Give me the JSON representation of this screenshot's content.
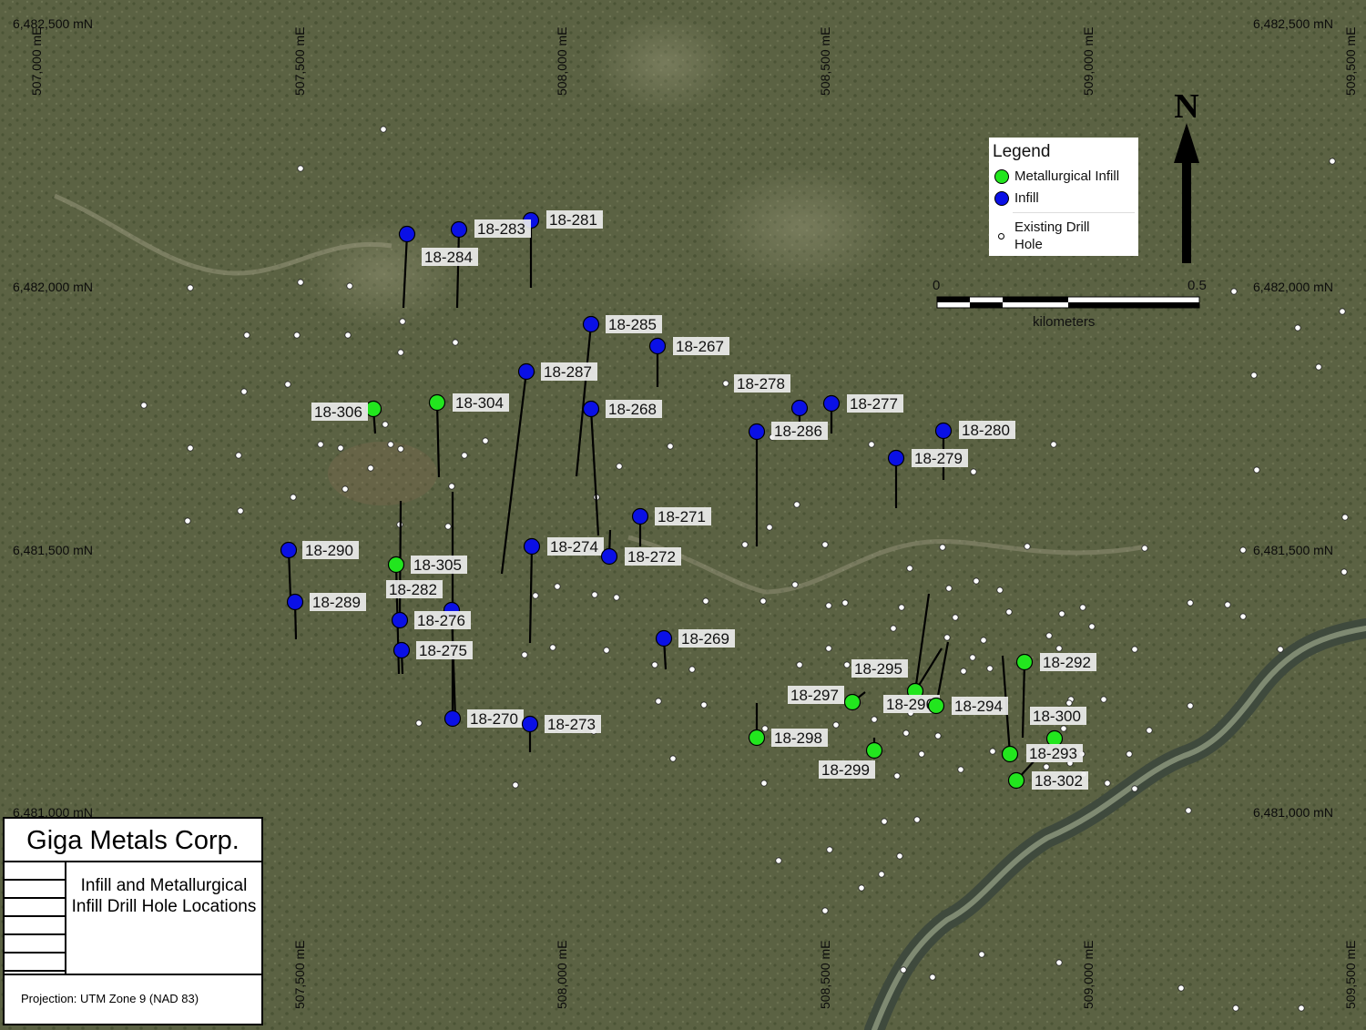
{
  "title_block": {
    "company": "Giga Metals Corp.",
    "description": "Infill and Metallurgical Infill Drill Hole Locations",
    "projection": "Projection: UTM Zone 9 (NAD 83)"
  },
  "legend": {
    "title": "Legend",
    "items": [
      {
        "label": "Metallurgical Infill",
        "color": "#22e61e"
      },
      {
        "label": "Infill",
        "color": "#0a10e6"
      },
      {
        "label": "Existing Drill Hole",
        "color": "#ffffff"
      }
    ]
  },
  "north_arrow": {
    "label": "N"
  },
  "scale_bar": {
    "start": "0",
    "end": "0.5",
    "unit": "kilometers"
  },
  "grid": {
    "northing": [
      "6,482,500 mN",
      "6,482,000 mN",
      "6,481,500 mN",
      "6,481,000 mN"
    ],
    "easting": [
      "507,000 mE",
      "507,500 mE",
      "508,000 mE",
      "508,500 mE",
      "509,000 mE",
      "509,500 mE"
    ]
  },
  "colors": {
    "terrain": "#5b6243",
    "infill": "#0a10e6",
    "metallurgical": "#22e61e",
    "river": "#3f4a3d"
  },
  "drill_holes": [
    {
      "id": "18-281",
      "type": "infill"
    },
    {
      "id": "18-283",
      "type": "infill"
    },
    {
      "id": "18-284",
      "type": "infill"
    },
    {
      "id": "18-285",
      "type": "infill"
    },
    {
      "id": "18-267",
      "type": "infill"
    },
    {
      "id": "18-287",
      "type": "infill"
    },
    {
      "id": "18-268",
      "type": "infill"
    },
    {
      "id": "18-278",
      "type": "infill"
    },
    {
      "id": "18-277",
      "type": "infill"
    },
    {
      "id": "18-286",
      "type": "infill"
    },
    {
      "id": "18-280",
      "type": "infill"
    },
    {
      "id": "18-279",
      "type": "infill"
    },
    {
      "id": "18-306",
      "type": "metallurgical"
    },
    {
      "id": "18-304",
      "type": "metallurgical"
    },
    {
      "id": "18-271",
      "type": "infill"
    },
    {
      "id": "18-290",
      "type": "infill"
    },
    {
      "id": "18-305",
      "type": "metallurgical"
    },
    {
      "id": "18-274",
      "type": "infill"
    },
    {
      "id": "18-272",
      "type": "infill"
    },
    {
      "id": "18-282",
      "type": "infill"
    },
    {
      "id": "18-289",
      "type": "infill"
    },
    {
      "id": "18-276",
      "type": "infill"
    },
    {
      "id": "18-275",
      "type": "infill"
    },
    {
      "id": "18-269",
      "type": "infill"
    },
    {
      "id": "18-270",
      "type": "infill"
    },
    {
      "id": "18-273",
      "type": "infill"
    },
    {
      "id": "18-295",
      "type": "metallurgical"
    },
    {
      "id": "18-292",
      "type": "metallurgical"
    },
    {
      "id": "18-297",
      "type": "metallurgical"
    },
    {
      "id": "18-296",
      "type": "metallurgical"
    },
    {
      "id": "18-294",
      "type": "metallurgical"
    },
    {
      "id": "18-300",
      "type": "metallurgical"
    },
    {
      "id": "18-298",
      "type": "metallurgical"
    },
    {
      "id": "18-293",
      "type": "metallurgical"
    },
    {
      "id": "18-299",
      "type": "metallurgical"
    },
    {
      "id": "18-302",
      "type": "metallurgical"
    }
  ]
}
